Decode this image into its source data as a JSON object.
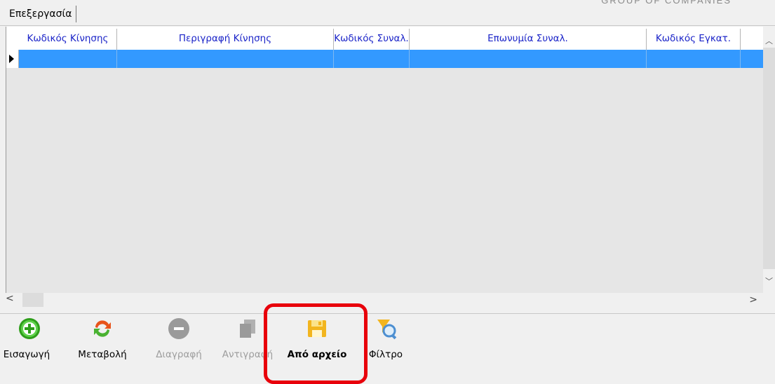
{
  "brand": "GROUP OF COMPANIES",
  "tab": {
    "label": "Επεξεργασία"
  },
  "grid": {
    "columns": [
      "Κωδικός Κίνησης",
      "Περιγραφή Κίνησης",
      "Κωδικός Συναλ.",
      "Επωνυμία Συναλ.",
      "Κωδικός Εγκατ."
    ]
  },
  "toolbar": {
    "insert": "Εισαγωγή",
    "modify": "Μεταβολή",
    "delete": "Διαγραφή",
    "copy": "Αντιγραφή",
    "from_file": "Από αρχείο",
    "filter": "Φίλτρο"
  },
  "colors": {
    "selection": "#3399ff",
    "header_text": "#1a23c8",
    "highlight": "#e8000b"
  }
}
